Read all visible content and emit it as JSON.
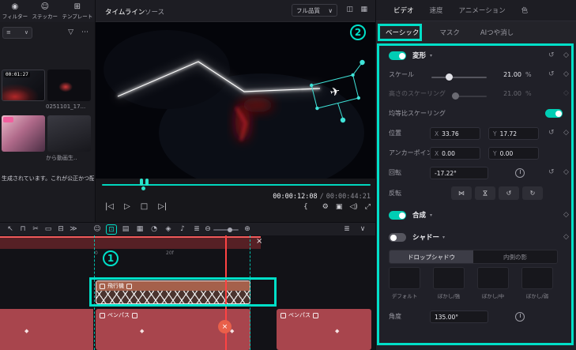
{
  "ui": {
    "accent": "#00dfc8",
    "caret_down": "▾",
    "select_caret": "∨",
    "reset_glyph": "↺",
    "keyframe_glyph": "◇",
    "keyframe_solid": "◆",
    "close_glyph": "×"
  },
  "left_toolbar": {
    "items": [
      {
        "name": "filter",
        "glyph": "◉",
        "label": "フィルター"
      },
      {
        "name": "sticker",
        "glyph": "☺",
        "label": "ステッカー"
      },
      {
        "name": "template",
        "glyph": "⊞",
        "label": "テンプレート"
      }
    ]
  },
  "media_panel": {
    "sort_glyph": "≡",
    "funnel_glyph": "▽",
    "more_glyph": "⋯",
    "clip1_duration": "00:01:27",
    "clip1_name": "0251101_17...",
    "clip2_name": "から動画生..",
    "description": "生成されています。これが公正かつ配..."
  },
  "preview_header": {
    "tabs": [
      {
        "label": "タイムライン",
        "active": true
      },
      {
        "label": "ソース",
        "active": false
      }
    ],
    "quality_label": "フル品質",
    "icons": [
      {
        "name": "compare-view",
        "glyph": "◫"
      },
      {
        "name": "grid-view",
        "glyph": "▦"
      }
    ]
  },
  "player": {
    "timecode_current": "00:00:12:08",
    "timecode_separator": "/",
    "timecode_total": "00:00:44:21",
    "transport": [
      {
        "name": "skip-start",
        "glyph": "|◁"
      },
      {
        "name": "play",
        "glyph": "▷"
      },
      {
        "name": "stop",
        "glyph": "□"
      },
      {
        "name": "skip-end",
        "glyph": "▷|"
      }
    ],
    "utilities": [
      {
        "name": "mark-in",
        "glyph": "{"
      },
      {
        "name": "mark-out",
        "glyph": "}"
      },
      {
        "name": "settings",
        "glyph": "⚙"
      },
      {
        "name": "snapshot",
        "glyph": "▣"
      },
      {
        "name": "volume",
        "glyph": "◁)"
      },
      {
        "name": "fullscreen",
        "glyph": "⤢"
      }
    ]
  },
  "inspector": {
    "tabs": [
      {
        "label": "ビデオ",
        "active": true
      },
      {
        "label": "速度",
        "active": false
      },
      {
        "label": "アニメーション",
        "active": false
      },
      {
        "label": "色",
        "active": false
      }
    ],
    "subtabs": [
      {
        "label": "ベーシック",
        "active": true
      },
      {
        "label": "マスク",
        "active": false
      },
      {
        "label": "AIつや消し",
        "active": false
      }
    ],
    "transform": {
      "title": "変形",
      "scale_label": "スケール",
      "scale_value": "21.00",
      "scale_unit": "%",
      "height_scale_label": "高さのスケーリング",
      "height_scale_value": "21.00",
      "height_scale_unit": "%",
      "uniform_scale_label": "均等比スケーリング",
      "position_label": "位置",
      "x_label": "X",
      "y_label": "Y",
      "position_x": "33.76",
      "position_y": "17.72",
      "anchor_label": "アンカーポイント",
      "anchor_x": "0.00",
      "anchor_y": "0.00",
      "rotate_label": "回転",
      "rotate_value": "-17.22°",
      "flip_label": "反転",
      "flip_buttons": [
        {
          "name": "flip-horizontal",
          "glyph": "⋈"
        },
        {
          "name": "flip-vertical",
          "glyph": "⋈"
        },
        {
          "name": "rotate-ccw",
          "glyph": "↺"
        },
        {
          "name": "rotate-cw",
          "glyph": "↻"
        }
      ]
    },
    "composite_title": "合成",
    "shadow": {
      "title": "シャドー",
      "modes": [
        {
          "label": "ドロップシャドウ",
          "active": true
        },
        {
          "label": "内側の影",
          "active": false
        }
      ],
      "presets": [
        {
          "label": "デフォルト"
        },
        {
          "label": "ぼかし/強"
        },
        {
          "label": "ぼかし/中"
        },
        {
          "label": "ぼかし/弱"
        }
      ],
      "angle_label": "角度",
      "angle_value": "135.00°"
    }
  },
  "timeline": {
    "toolbar_left": [
      {
        "name": "select-tool",
        "glyph": "↖"
      },
      {
        "name": "magnet-tool",
        "glyph": "⊓"
      },
      {
        "name": "razor-tool",
        "glyph": "✂"
      },
      {
        "name": "trim-tool",
        "glyph": "▭"
      },
      {
        "name": "delete-tool",
        "glyph": "⊟"
      },
      {
        "name": "more-tools",
        "glyph": "≫"
      }
    ],
    "toolbar_center": [
      {
        "name": "sticker-tool",
        "glyph": "☺"
      },
      {
        "name": "crop-tool",
        "glyph": "⊡"
      },
      {
        "name": "effects-tool",
        "glyph": "▤"
      },
      {
        "name": "grid-tool",
        "glyph": "▦"
      },
      {
        "name": "speed-tool",
        "glyph": "◔"
      },
      {
        "name": "mask-tool",
        "glyph": "◈"
      },
      {
        "name": "voiceover-tool",
        "glyph": "♪"
      },
      {
        "name": "mixer-tool",
        "glyph": "≣"
      }
    ],
    "zoom_out_glyph": "⊖",
    "zoom_in_glyph": "⊕",
    "toolbar_right": [
      {
        "name": "track-options",
        "glyph": "≣"
      },
      {
        "name": "collapse",
        "glyph": "∨"
      }
    ],
    "ruler_marks": [
      {
        "label": "0"
      },
      {
        "label": "20f"
      }
    ],
    "clips": {
      "airplane": "飛行機",
      "pen_a": "ペンパス",
      "pen_b": "ペンパス"
    }
  },
  "annotations": {
    "step1": "1",
    "step2": "2"
  }
}
